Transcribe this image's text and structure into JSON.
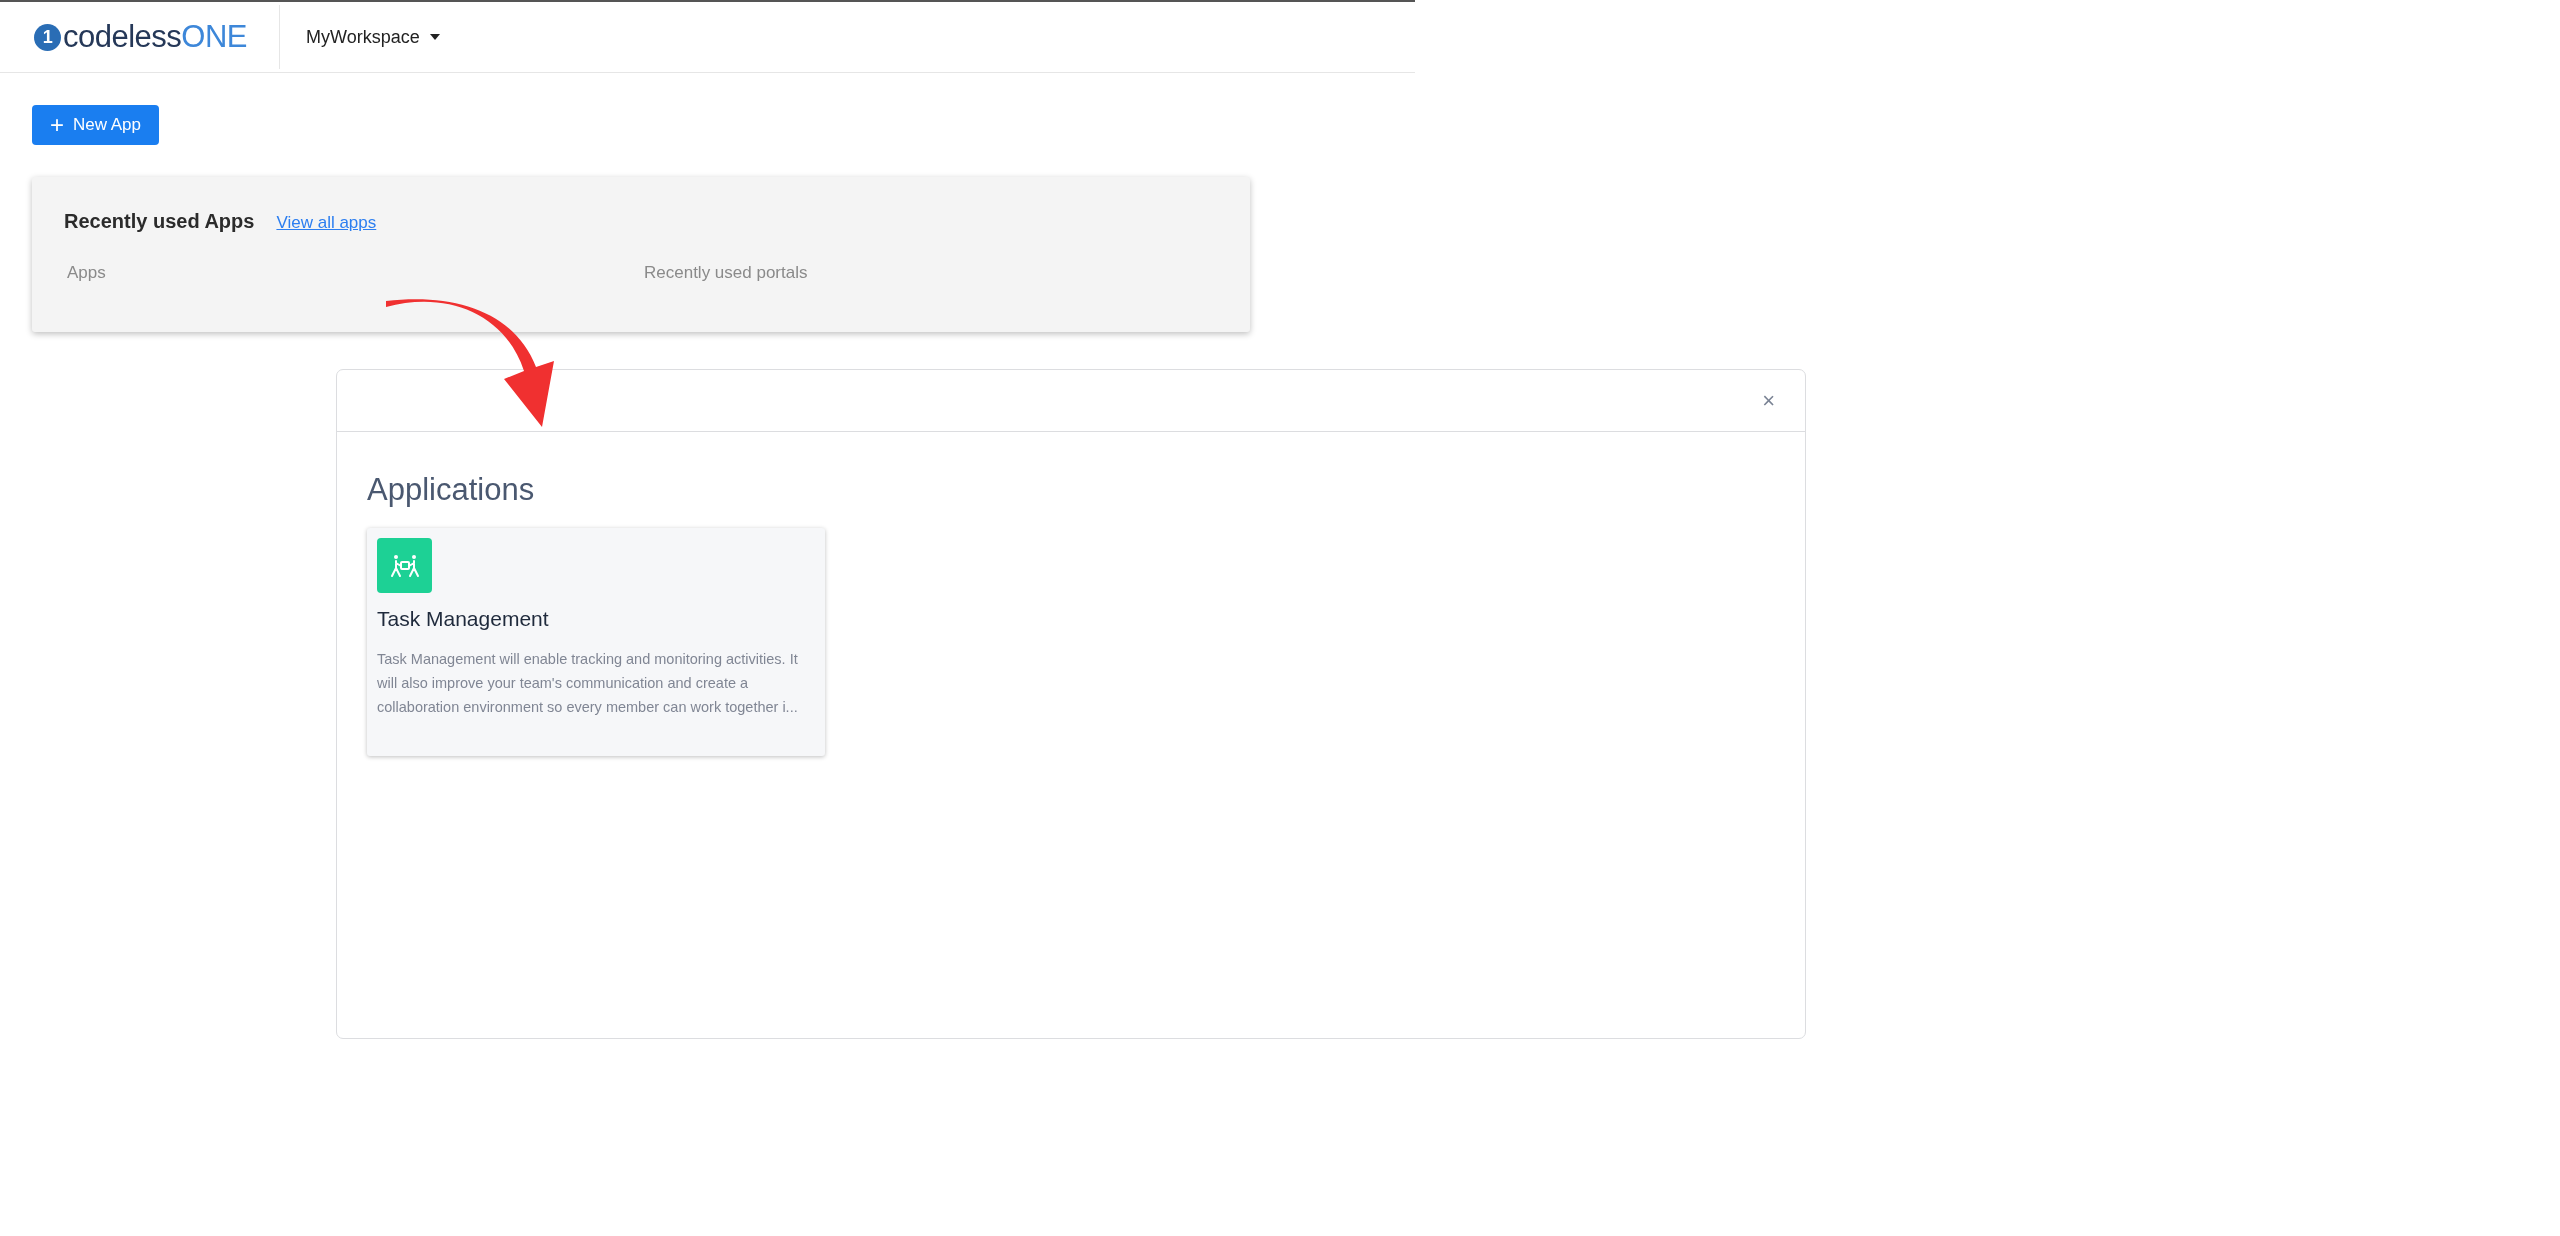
{
  "header": {
    "logo": {
      "mark": "1",
      "text_dark": "codeless",
      "text_brand": "ONE"
    },
    "workspace": "MyWorkspace"
  },
  "new_app_button": {
    "icon": "+",
    "label": "New App"
  },
  "recent_panel": {
    "title": "Recently used Apps",
    "link": "View all apps",
    "columns": [
      "Apps",
      "Recently used portals"
    ]
  },
  "dialog": {
    "close": "×",
    "title": "Applications",
    "apps": [
      {
        "name": "Task Management",
        "description": "Task Management will enable tracking and monitoring activities. It will also improve your team's communication and create a collaboration environment so every member can work together i...",
        "color": "#1dd195"
      }
    ]
  }
}
